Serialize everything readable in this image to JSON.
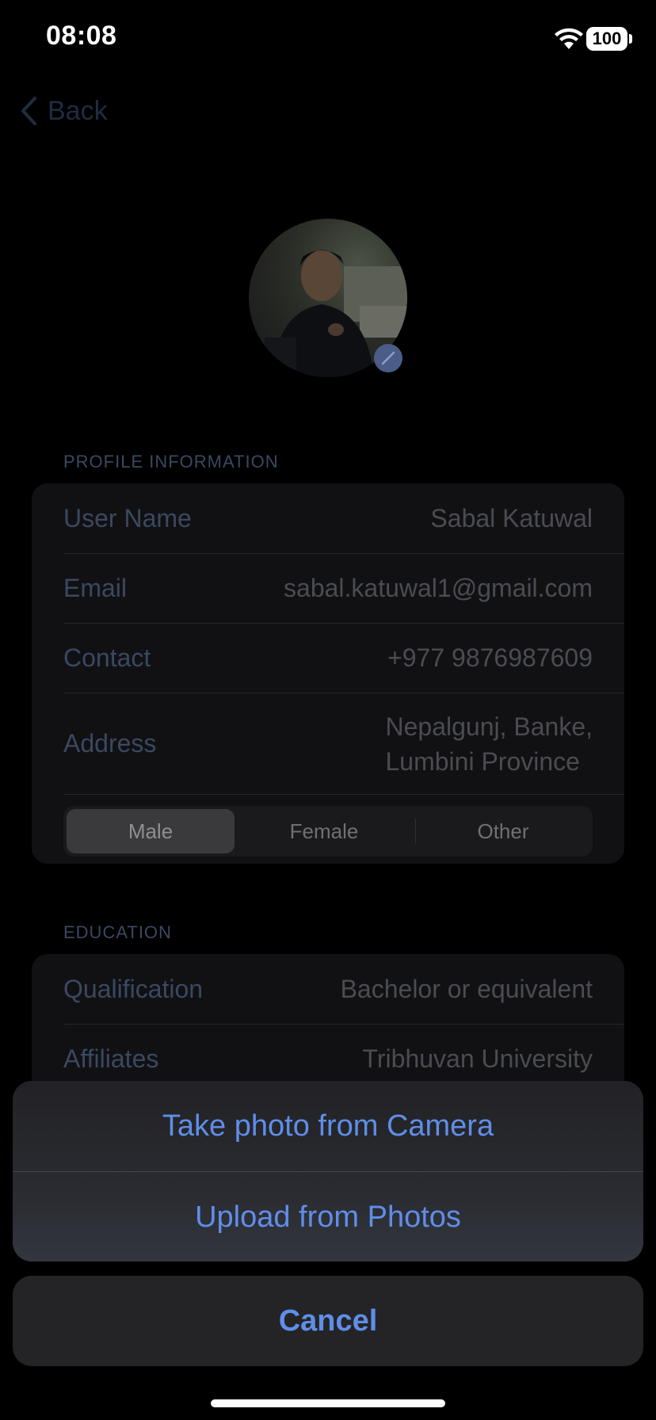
{
  "status_bar": {
    "time": "08:08",
    "battery": "100"
  },
  "nav": {
    "back_label": "Back"
  },
  "profile_section": {
    "header": "PROFILE INFORMATION",
    "rows": [
      {
        "label": "User Name",
        "value": "Sabal Katuwal"
      },
      {
        "label": "Email",
        "value": "sabal.katuwal1@gmail.com"
      },
      {
        "label": "Contact",
        "value": "+977  9876987609"
      },
      {
        "label": "Address",
        "value_line1": "Nepalgunj, Banke,",
        "value_line2": "Lumbini Province"
      }
    ],
    "gender": {
      "options": [
        "Male",
        "Female",
        "Other"
      ],
      "selected": "Male"
    }
  },
  "education_section": {
    "header": "EDUCATION",
    "rows": [
      {
        "label": "Qualification",
        "value": "Bachelor or equivalent"
      },
      {
        "label": "Affiliates",
        "value": "Tribhuvan University"
      }
    ]
  },
  "action_sheet": {
    "options": [
      "Take photo from Camera",
      "Upload from Photos"
    ],
    "cancel": "Cancel",
    "accent_color": "#5f8ee8"
  }
}
